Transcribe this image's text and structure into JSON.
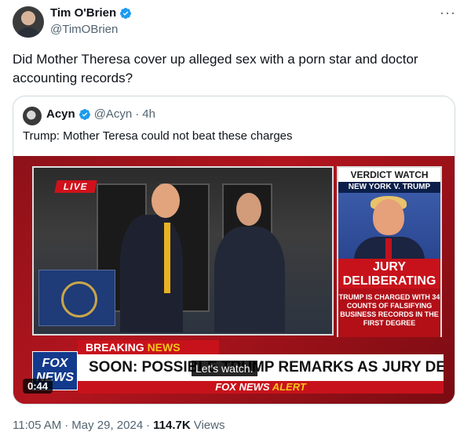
{
  "author": {
    "name": "Tim O'Brien",
    "handle": "@TimOBrien",
    "verified": true
  },
  "more_glyph": "···",
  "tweet": {
    "text": "Did Mother Theresa cover up alleged sex with a porn star and doctor accounting records?"
  },
  "quoted": {
    "name": "Acyn",
    "handle": "@Acyn",
    "separator": "·",
    "age": "4h",
    "text": "Trump: Mother Teresa could not beat these charges",
    "video": {
      "live_badge": "LIVE",
      "panel_title": "VERDICT WATCH",
      "panel_subtitle": "NEW YORK V. TRUMP",
      "jury_line1": "JURY",
      "jury_line2": "DELIBERATING",
      "jury_description": "TRUMP IS CHARGED WITH 34 COUNTS OF FALSIFYING BUSINESS RECORDS IN THE FIRST DEGREE",
      "breaking_prefix": "BREAKING",
      "breaking_suffix": "NEWS",
      "fox_logo_line1": "FOX",
      "fox_logo_line2": "NEWS",
      "ticker_text": "SOON: POSSIBLE TRUMP REMARKS AS JURY DELIBERATES",
      "alert_prefix": "FOX NEWS",
      "alert_suffix": "ALERT",
      "caption": "Let's watch.",
      "duration": "0:44"
    }
  },
  "footer": {
    "time": "11:05 AM",
    "dot": "·",
    "date": "May 29, 2024",
    "dot2": "·",
    "views_count": "114.7K",
    "views_label": "Views"
  },
  "colors": {
    "verified_blue": "#1d9bf0",
    "secondary_text": "#536471",
    "fox_red": "#c8121b",
    "fox_blue": "#133a8c"
  }
}
